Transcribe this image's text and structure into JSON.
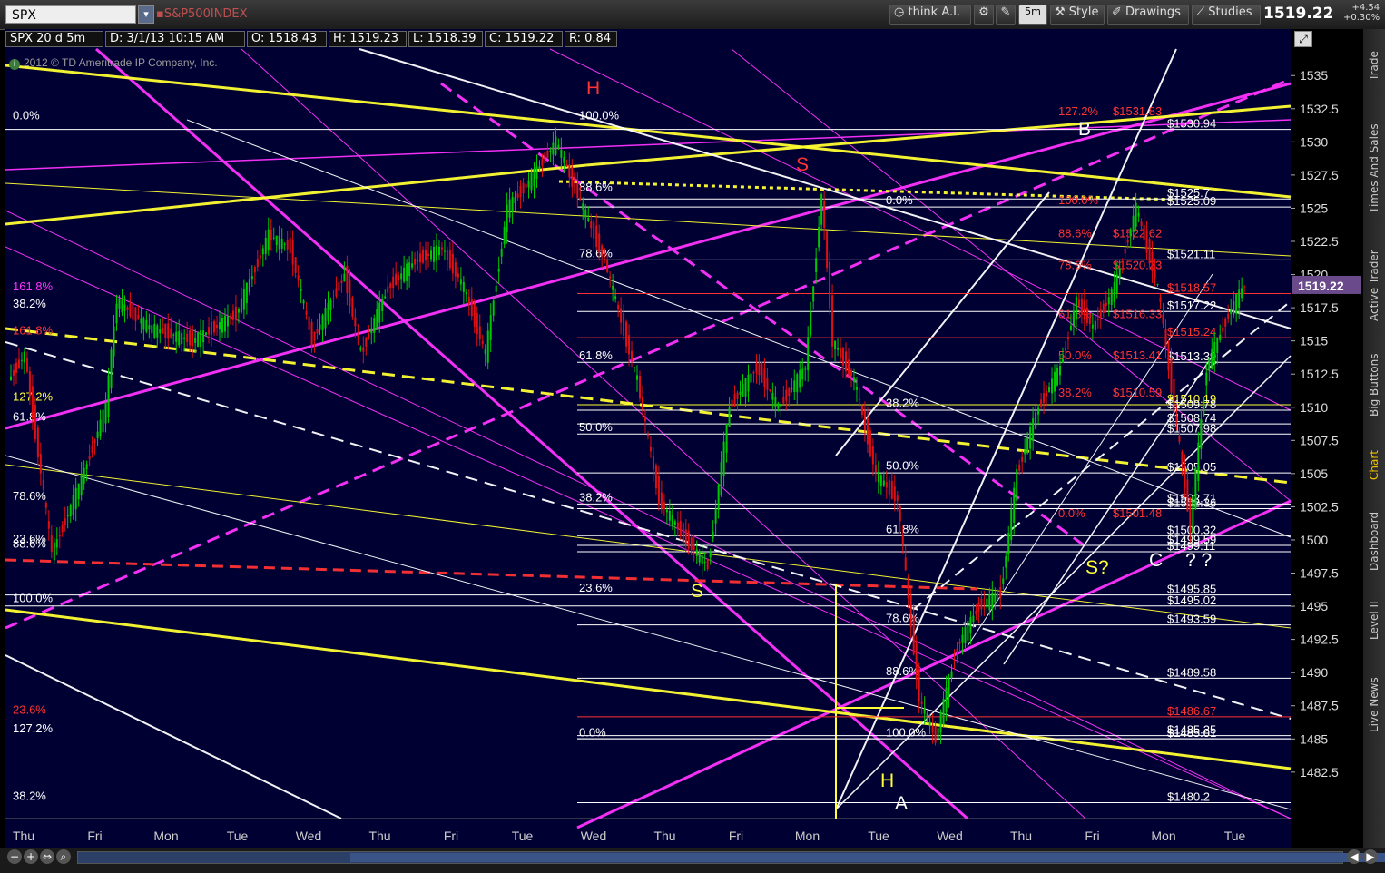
{
  "toolbar": {
    "symbol": "SPX",
    "description": "S&P500INDEX",
    "think_ai": "think A.I.",
    "timeframe": "5m",
    "style": "Style",
    "drawings": "Drawings",
    "studies": "Studies",
    "last_price": "1519.22",
    "change_abs": "+4.54",
    "change_pct": "+0.30%"
  },
  "infobar": {
    "title": "SPX 20 d 5m",
    "date": "D: 3/1/13 10:15 AM",
    "open": "O: 1518.43",
    "high": "H: 1519.23",
    "low": "L: 1518.39",
    "close": "C: 1519.22",
    "range": "R: 0.84"
  },
  "copyright": "2012 © TD Ameritrade IP Company, Inc.",
  "side_tabs": [
    "Trade",
    "Times And Sales",
    "Active Trader",
    "Big Buttons",
    "Chart",
    "Dashboard",
    "Level II",
    "Live News"
  ],
  "colors": {
    "background": "#000033",
    "up_candle": "#00c800",
    "down_candle": "#e01010",
    "magenta": "#ff33ff",
    "yellow": "#ffff33",
    "white": "#ffffff",
    "red": "#ff3333",
    "price_tag": "#6a4a8a"
  },
  "chart_data": {
    "type": "candlestick",
    "symbol": "SPX",
    "aggregation": "5m",
    "span": "20 d",
    "ylim": [
      1479,
      1537
    ],
    "y_ticks": [
      "1535",
      "1532.5",
      "1530",
      "1527.5",
      "1525",
      "1522.5",
      "1520",
      "1517.5",
      "1515",
      "1512.5",
      "1510",
      "1507.5",
      "1505",
      "1502.5",
      "1500",
      "1497.5",
      "1495",
      "1492.5",
      "1490",
      "1487.5",
      "1485",
      "1482.5"
    ],
    "x_ticks": [
      "Thu",
      "Fri",
      "Mon",
      "Tue",
      "Wed",
      "Thu",
      "Fri",
      "Tue",
      "Wed",
      "Thu",
      "Fri",
      "Mon",
      "Tue",
      "Wed",
      "Thu",
      "Fri",
      "Mon",
      "Tue"
    ],
    "last_value": "1519.22",
    "close_path": [
      [
        0,
        1512
      ],
      [
        0.3,
        1514
      ],
      [
        0.8,
        1499
      ],
      [
        1.3,
        1504
      ],
      [
        1.8,
        1510
      ],
      [
        2.0,
        1518
      ],
      [
        2.6,
        1516
      ],
      [
        3.4,
        1515
      ],
      [
        4.2,
        1517
      ],
      [
        4.8,
        1523
      ],
      [
        5.2,
        1522
      ],
      [
        5.6,
        1515
      ],
      [
        6.2,
        1520
      ],
      [
        6.5,
        1514
      ],
      [
        7.0,
        1519
      ],
      [
        7.5,
        1521
      ],
      [
        8.0,
        1522
      ],
      [
        8.4,
        1519
      ],
      [
        8.8,
        1514
      ],
      [
        9.2,
        1525
      ],
      [
        9.6,
        1527
      ],
      [
        10.1,
        1530
      ],
      [
        10.5,
        1526
      ],
      [
        11.0,
        1521
      ],
      [
        11.6,
        1512
      ],
      [
        12.0,
        1503
      ],
      [
        12.5,
        1500
      ],
      [
        12.9,
        1498
      ],
      [
        13.3,
        1510
      ],
      [
        13.8,
        1513
      ],
      [
        14.2,
        1510
      ],
      [
        14.7,
        1513
      ],
      [
        15.0,
        1526
      ],
      [
        15.2,
        1515
      ],
      [
        15.6,
        1512
      ],
      [
        16.0,
        1505
      ],
      [
        16.4,
        1503
      ],
      [
        16.8,
        1488
      ],
      [
        17.1,
        1485
      ],
      [
        17.5,
        1492
      ],
      [
        17.9,
        1495
      ],
      [
        18.3,
        1496
      ],
      [
        18.6,
        1505
      ],
      [
        19.0,
        1510
      ],
      [
        19.4,
        1513
      ],
      [
        19.7,
        1518
      ],
      [
        20.0,
        1516
      ],
      [
        20.4,
        1519
      ],
      [
        20.8,
        1525
      ],
      [
        21.2,
        1519
      ],
      [
        21.5,
        1510
      ],
      [
        21.8,
        1501
      ],
      [
        22.1,
        1513
      ],
      [
        22.5,
        1517
      ],
      [
        22.8,
        1519.22
      ]
    ],
    "horizontal_levels": [
      {
        "label": "$1530.94",
        "value": 1530.94
      },
      {
        "label": "$1525.7",
        "value": 1525.7
      },
      {
        "label": "$1525.09",
        "value": 1525.09
      },
      {
        "label": "$1521.11",
        "value": 1521.11
      },
      {
        "label": "$1518.57",
        "value": 1518.57
      },
      {
        "label": "$1517.22",
        "value": 1517.22
      },
      {
        "label": "$1515.24",
        "value": 1515.24
      },
      {
        "label": "$1513.39",
        "value": 1513.39
      },
      {
        "label": "$1510.19",
        "value": 1510.19
      },
      {
        "label": "$1509.78",
        "value": 1509.78
      },
      {
        "label": "$1508.74",
        "value": 1508.74
      },
      {
        "label": "$1507.98",
        "value": 1507.98
      },
      {
        "label": "$1505.05",
        "value": 1505.05
      },
      {
        "label": "$1502.71",
        "value": 1502.71
      },
      {
        "label": "$1502.36",
        "value": 1502.36
      },
      {
        "label": "$1500.32",
        "value": 1500.32
      },
      {
        "label": "$1499.59",
        "value": 1499.59
      },
      {
        "label": "$1499.11",
        "value": 1499.11
      },
      {
        "label": "$1495.85",
        "value": 1495.85
      },
      {
        "label": "$1495.02",
        "value": 1495.02
      },
      {
        "label": "$1493.59",
        "value": 1493.59
      },
      {
        "label": "$1489.58",
        "value": 1489.58
      },
      {
        "label": "$1486.67",
        "value": 1486.67
      },
      {
        "label": "$1485.25",
        "value": 1485.25
      },
      {
        "label": "$1485.01",
        "value": 1485.01
      },
      {
        "label": "$1485.01",
        "value": 1485.01
      },
      {
        "label": "$1480.2",
        "value": 1480.2
      }
    ],
    "fib_labels": [
      {
        "text": "0.0%",
        "value": 1531.5,
        "color": "white"
      },
      {
        "text": "161.8%",
        "value": 1518.6,
        "color": "magenta"
      },
      {
        "text": "38.2%",
        "value": 1517.3,
        "color": "white"
      },
      {
        "text": "161.8%",
        "value": 1515.3,
        "color": "red"
      },
      {
        "text": "127.2%",
        "value": 1510.3,
        "color": "yellow"
      },
      {
        "text": "61.8%",
        "value": 1508.8,
        "color": "white"
      },
      {
        "text": "78.6%",
        "value": 1502.8,
        "color": "white"
      },
      {
        "text": "23.6%",
        "value": 1499.6,
        "color": "white"
      },
      {
        "text": "88.6%",
        "value": 1499.2,
        "color": "white"
      },
      {
        "text": "100.0%",
        "value": 1495.1,
        "color": "white"
      },
      {
        "text": "23.6%",
        "value": 1486.7,
        "color": "red"
      },
      {
        "text": "127.2%",
        "value": 1485.3,
        "color": "white"
      },
      {
        "text": "38.2%",
        "value": 1480.2,
        "color": "white"
      },
      {
        "text": "100.0%",
        "value": 1531.5,
        "color": "white"
      },
      {
        "text": "88.6%",
        "value": 1526.1,
        "color": "white"
      },
      {
        "text": "78.6%",
        "value": 1521.1,
        "color": "white"
      },
      {
        "text": "61.8%",
        "value": 1513.4,
        "color": "white"
      },
      {
        "text": "50.0%",
        "value": 1508.0,
        "color": "white"
      },
      {
        "text": "38.2%",
        "value": 1502.7,
        "color": "white"
      },
      {
        "text": "23.6%",
        "value": 1495.9,
        "color": "white"
      },
      {
        "text": "0.0%",
        "value": 1485.0,
        "color": "white"
      },
      {
        "text": "0.0%",
        "value": 1525.1,
        "color": "white"
      },
      {
        "text": "38.2%",
        "value": 1509.8,
        "color": "white"
      },
      {
        "text": "50.0%",
        "value": 1505.1,
        "color": "white"
      },
      {
        "text": "61.8%",
        "value": 1500.3,
        "color": "white"
      },
      {
        "text": "78.6%",
        "value": 1493.6,
        "color": "white"
      },
      {
        "text": "88.6%",
        "value": 1489.6,
        "color": "white"
      },
      {
        "text": "100.0%",
        "value": 1485.0,
        "color": "white"
      },
      {
        "text": "127.2%",
        "value": 1531.8,
        "color": "red"
      },
      {
        "text": "$1531.83",
        "value": 1531.8,
        "color": "red"
      },
      {
        "text": "100.0%",
        "value": 1525.1,
        "color": "red"
      },
      {
        "text": "88.6%",
        "value": 1522.6,
        "color": "red"
      },
      {
        "text": "$1522.62",
        "value": 1522.6,
        "color": "red"
      },
      {
        "text": "78.6%",
        "value": 1520.2,
        "color": "red"
      },
      {
        "text": "$1520.23",
        "value": 1520.2,
        "color": "red"
      },
      {
        "text": "61.8%",
        "value": 1516.5,
        "color": "red"
      },
      {
        "text": "$1516.33",
        "value": 1516.5,
        "color": "red"
      },
      {
        "text": "50.0%",
        "value": 1513.4,
        "color": "red"
      },
      {
        "text": "$1513.41",
        "value": 1513.4,
        "color": "red"
      },
      {
        "text": "38.2%",
        "value": 1510.6,
        "color": "red"
      },
      {
        "text": "$1510.59",
        "value": 1510.6,
        "color": "red"
      },
      {
        "text": "0.0%",
        "value": 1501.5,
        "color": "red"
      },
      {
        "text": "$1501.48",
        "value": 1501.5,
        "color": "red"
      }
    ],
    "annotations": [
      {
        "text": "H",
        "color": "red"
      },
      {
        "text": "S",
        "color": "red"
      },
      {
        "text": "S",
        "color": "yellow"
      },
      {
        "text": "H",
        "color": "yellow"
      },
      {
        "text": "A",
        "color": "white"
      },
      {
        "text": "B",
        "color": "white"
      },
      {
        "text": "S?",
        "color": "yellow"
      },
      {
        "text": "C",
        "color": "white"
      },
      {
        "text": "? ?",
        "color": "white"
      }
    ]
  }
}
